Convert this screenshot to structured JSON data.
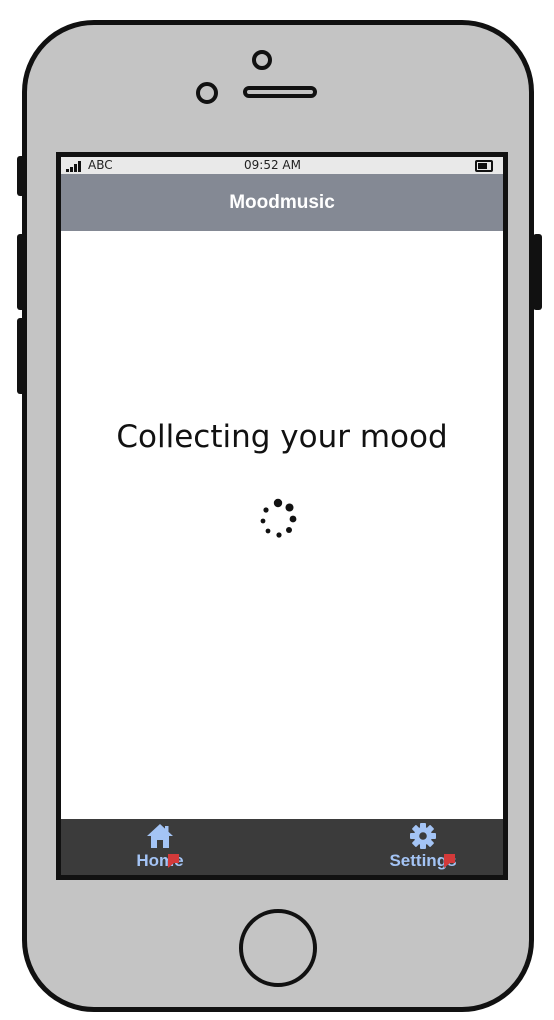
{
  "status_bar": {
    "carrier": "ABC",
    "time": "09:52 AM"
  },
  "nav_bar": {
    "title": "Moodmusic"
  },
  "main": {
    "message": "Collecting your mood"
  },
  "tab_bar": {
    "items": [
      {
        "label": "Home",
        "icon": "home-icon"
      },
      {
        "label": "Settings",
        "icon": "gear-icon"
      }
    ]
  },
  "colors": {
    "nav_bar_bg": "#848994",
    "tab_bar_bg": "#3b3b3b",
    "tab_label": "#a4c4f5",
    "phone_body": "#c4c4c4"
  }
}
